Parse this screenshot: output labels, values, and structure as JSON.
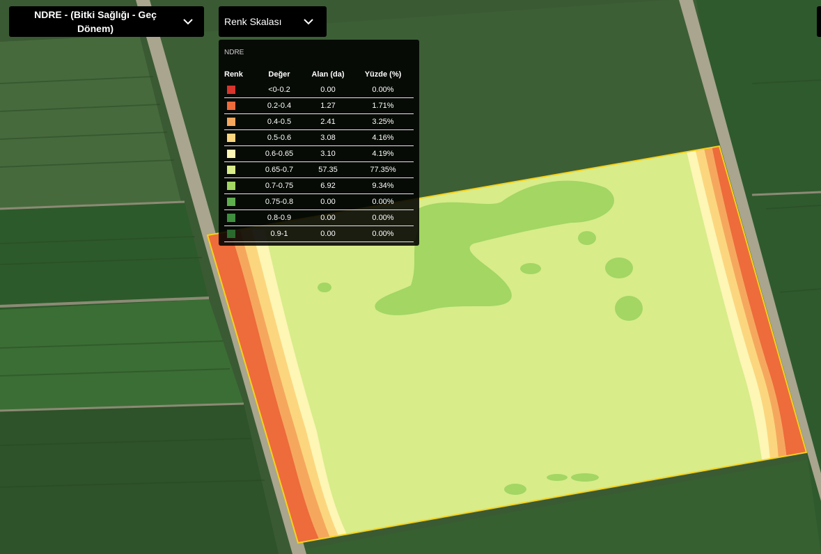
{
  "layer_selector": {
    "label": "NDRE - (Bitki Sağlığı - Geç Dönem)",
    "icon": "chevron-down-icon"
  },
  "scale_selector": {
    "label": "Renk Skalası",
    "icon": "chevron-down-icon"
  },
  "legend": {
    "title": "NDRE",
    "headers": {
      "color": "Renk",
      "value": "Değer",
      "area": "Alan (da)",
      "percent": "Yüzde (%)"
    },
    "rows": [
      {
        "color": "#d7352d",
        "value": "<0-0.2",
        "area": "0.00",
        "percent": "0.00%"
      },
      {
        "color": "#ee6b3b",
        "value": "0.2-0.4",
        "area": "1.27",
        "percent": "1.71%"
      },
      {
        "color": "#f6a75e",
        "value": "0.4-0.5",
        "area": "2.41",
        "percent": "3.25%"
      },
      {
        "color": "#fcd67f",
        "value": "0.5-0.6",
        "area": "3.08",
        "percent": "4.16%"
      },
      {
        "color": "#fdf6b5",
        "value": "0.6-0.65",
        "area": "3.10",
        "percent": "4.19%"
      },
      {
        "color": "#d8ec8a",
        "value": "0.65-0.7",
        "area": "57.35",
        "percent": "77.35%"
      },
      {
        "color": "#a3d663",
        "value": "0.7-0.75",
        "area": "6.92",
        "percent": "9.34%"
      },
      {
        "color": "#5fae4e",
        "value": "0.75-0.8",
        "area": "0.00",
        "percent": "0.00%"
      },
      {
        "color": "#3f8f3f",
        "value": "0.8-0.9",
        "area": "0.00",
        "percent": "0.00%"
      },
      {
        "color": "#2a6a2e",
        "value": "0.9-1",
        "area": "0.00",
        "percent": "0.00%"
      }
    ]
  },
  "field": {
    "boundary_color": "#f5d21c",
    "base_color": "#d8ec8a",
    "patch_color": "#a3d663"
  }
}
